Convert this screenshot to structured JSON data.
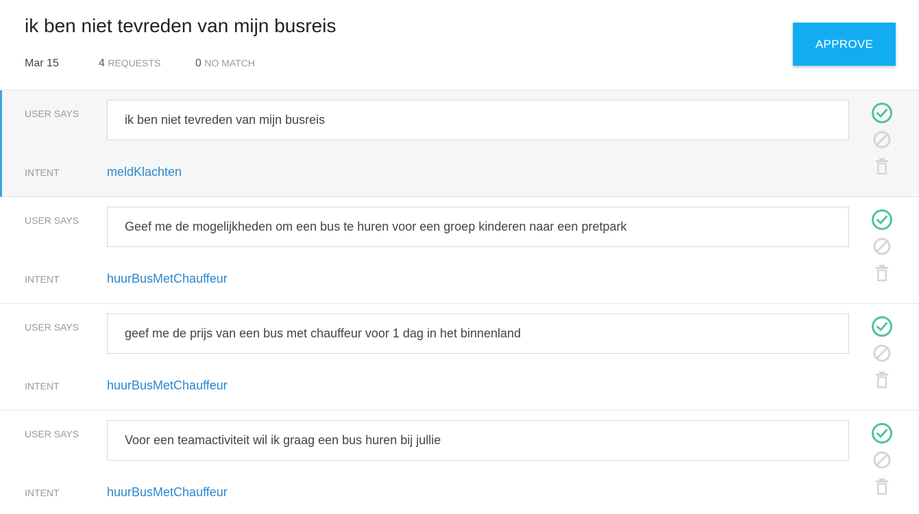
{
  "header": {
    "title": "ik ben niet tevreden van mijn busreis",
    "date": "Mar 15",
    "requests_count": "4",
    "requests_label": "REQUESTS",
    "nomatch_count": "0",
    "nomatch_label": "NO MATCH",
    "approve_label": "APPROVE"
  },
  "labels": {
    "user_says": "USER SAYS",
    "intent": "INTENT"
  },
  "rows": [
    {
      "utterance": "ik ben niet tevreden van mijn busreis",
      "intent": "meldKlachten",
      "selected": true
    },
    {
      "utterance": "Geef me de mogelijkheden om een bus te huren voor een groep kinderen naar een pretpark",
      "intent": "huurBusMetChauffeur",
      "selected": false
    },
    {
      "utterance": "geef me de prijs van een bus met chauffeur voor 1 dag in het binnenland",
      "intent": "huurBusMetChauffeur",
      "selected": false
    },
    {
      "utterance": "Voor een teamactiviteit wil ik graag een bus huren bij jullie",
      "intent": "huurBusMetChauffeur",
      "selected": false
    }
  ],
  "icons": {
    "approve": "check-circle-icon",
    "reject": "block-icon",
    "delete": "trash-icon"
  },
  "colors": {
    "accent": "#12acf3",
    "approve_icon": "#4fc3a1",
    "muted_icon": "#d6d6d6",
    "link": "#2a87d0",
    "selected_border": "#3aa3e3"
  }
}
